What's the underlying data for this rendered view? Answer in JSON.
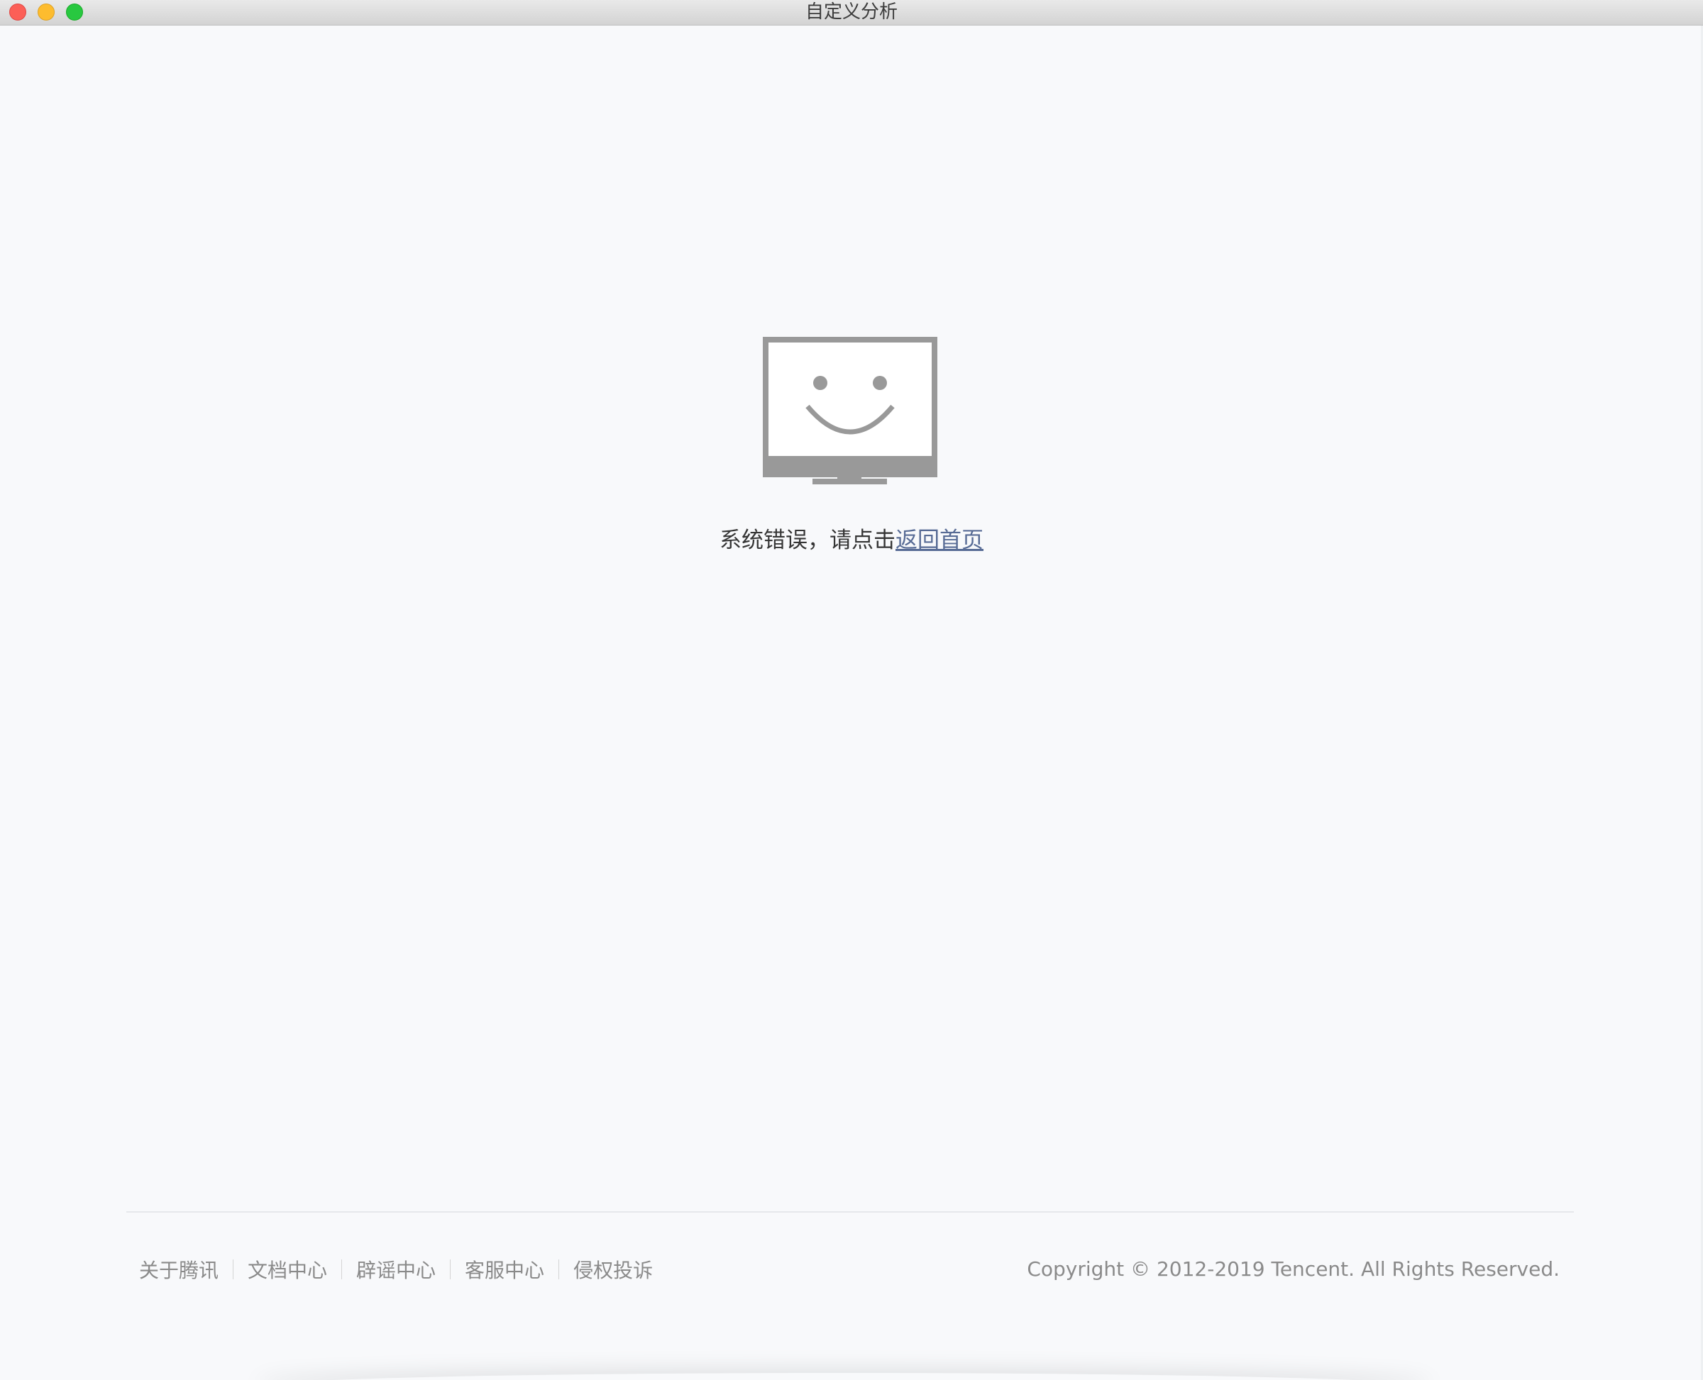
{
  "window": {
    "title": "自定义分析"
  },
  "error": {
    "message": "系统错误，请点击",
    "link_label": "返回首页"
  },
  "footer": {
    "links": [
      {
        "label": "关于腾讯"
      },
      {
        "label": "文档中心"
      },
      {
        "label": "辟谣中心"
      },
      {
        "label": "客服中心"
      },
      {
        "label": "侵权投诉"
      }
    ],
    "copyright": "Copyright © 2012-2019 Tencent. All Rights Reserved."
  },
  "icons": {
    "error_illustration": "smiling-monitor-icon"
  },
  "colors": {
    "background": "#f8f9fb",
    "link": "#576b95",
    "text": "#353535",
    "footer_text": "#8a8a8a",
    "icon_gray": "#999999"
  }
}
